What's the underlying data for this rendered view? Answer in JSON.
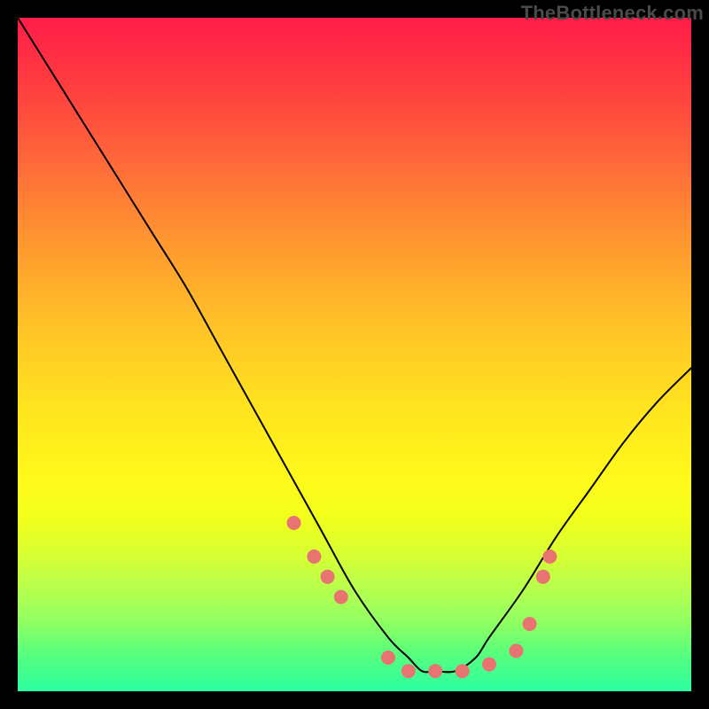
{
  "watermark": "TheBottleneck.com",
  "chart_data": {
    "type": "line",
    "title": "",
    "xlabel": "",
    "ylabel": "",
    "xlim": [
      0,
      100
    ],
    "ylim": [
      0,
      100
    ],
    "series": [
      {
        "name": "bottleneck-curve",
        "x": [
          0,
          5,
          10,
          15,
          20,
          25,
          30,
          35,
          40,
          45,
          50,
          55,
          58,
          60,
          62,
          65,
          68,
          70,
          75,
          80,
          85,
          90,
          95,
          100
        ],
        "values": [
          100,
          92,
          84,
          76,
          68,
          60,
          51,
          42,
          33,
          24,
          15,
          8,
          5,
          3,
          3,
          3,
          5,
          8,
          15,
          23,
          30,
          37,
          43,
          48
        ]
      }
    ],
    "markers": {
      "name": "highlight-dots",
      "x": [
        41,
        44,
        46,
        48,
        55,
        58,
        62,
        66,
        70,
        74,
        76,
        78,
        79
      ],
      "values": [
        25,
        20,
        17,
        14,
        5,
        3,
        3,
        3,
        4,
        6,
        10,
        17,
        20
      ],
      "radius_px": 8,
      "color": "#e97371"
    },
    "gradient_stops": [
      {
        "pos": 0.0,
        "color": "#ff1c49"
      },
      {
        "pos": 0.5,
        "color": "#ffe41f"
      },
      {
        "pos": 1.0,
        "color": "#2cffa1"
      }
    ]
  }
}
